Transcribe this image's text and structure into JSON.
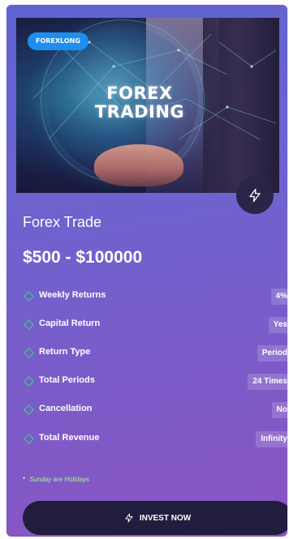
{
  "card": {
    "badge": "FOREXLONG",
    "hero_text": "FOREX TRADING",
    "plan_name": "Forex Trade",
    "price_range": "$500 - $100000",
    "features": [
      {
        "label": "Weekly Returns",
        "value": "4%"
      },
      {
        "label": "Capital Return",
        "value": "Yes"
      },
      {
        "label": "Return Type",
        "value": "Period"
      },
      {
        "label": "Total Periods",
        "value": "24 Times"
      },
      {
        "label": "Cancellation",
        "value": "No"
      },
      {
        "label": "Total Revenue",
        "value": "Infinity"
      }
    ],
    "note_star": "*",
    "note": "Sunday are Holidays",
    "invest_label": "INVEST NOW",
    "icons": {
      "bolt": "lightning-bolt-icon",
      "bullet": "diamond-icon"
    }
  },
  "colors": {
    "card_gradient_start": "#5f63d1",
    "card_gradient_end": "#8a55c2",
    "badge_bg": "#1e8ef0",
    "button_bg": "#211d3c",
    "bullet": "#36d98a",
    "note": "#9dff8a"
  }
}
